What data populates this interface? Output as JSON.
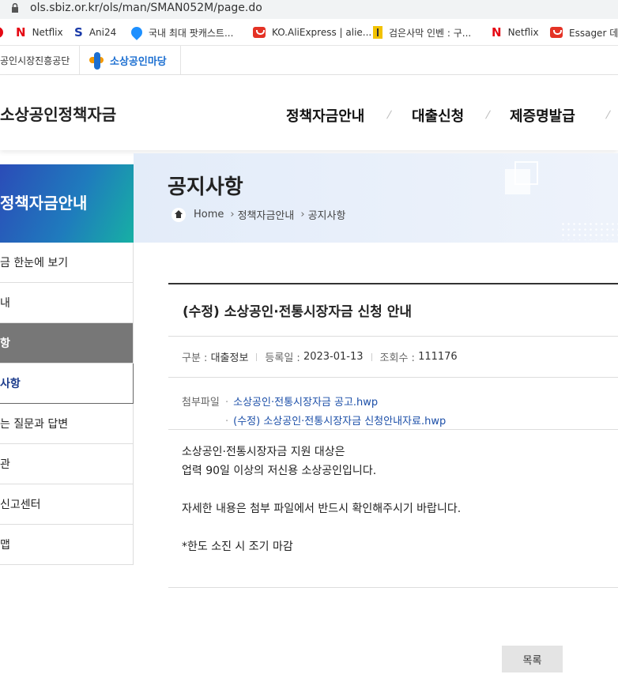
{
  "browser": {
    "url": "ols.sbiz.or.kr/ols/man/SMAN052M/page.do",
    "bookmarks": [
      {
        "label": "Netflix",
        "icon": "netflix-icon"
      },
      {
        "label": "Ani24",
        "icon": "ani24-icon"
      },
      {
        "label": "국내 최대 팟캐스트...",
        "icon": "podcast-icon"
      },
      {
        "label": "KO.AliExpress | alie...",
        "icon": "aliexpress-icon"
      },
      {
        "label": "검은사막 인벤 : 구...",
        "icon": "inven-icon"
      },
      {
        "label": "Netflix",
        "icon": "netflix-icon"
      },
      {
        "label": "Essager 데스",
        "icon": "aliexpress-icon"
      }
    ]
  },
  "site_top": {
    "org_link": "공인시장진흥공단",
    "portal_logo_text": "소상공인마당"
  },
  "header": {
    "brand": "소상공인정책자금",
    "menu": [
      "정책자금안내",
      "대출신청",
      "제증명발급"
    ]
  },
  "banner": {
    "section_title": "정책자금안내",
    "page_title": "공지사항",
    "breadcrumb": [
      "Home",
      "정책자금안내",
      "공지사항"
    ]
  },
  "side_menu": [
    "금 한눈에 보기",
    "내",
    "항",
    "사항",
    "는 질문과 답변",
    "관",
    "신고센터",
    "맵"
  ],
  "notice": {
    "title": "(수정) 소상공인·전통시장자금 신청 안내",
    "category_label": "구분 :",
    "category": "대출정보",
    "date_label": "등록일 :",
    "date": "2023-01-13",
    "views_label": "조회수 :",
    "views": "111176",
    "attach_label": "첨부파일",
    "attachments": [
      "소상공인·전통시장자금 공고.hwp",
      "(수정) 소상공인·전통시장자금 신청안내자료.hwp"
    ],
    "body": [
      "소상공인·전통시장자금 지원 대상은",
      "업력 90일 이상의 저신용 소상공인입니다.",
      "자세한 내용은 첨부 파일에서 반드시 확인해주시기 바랍니다.",
      "*한도 소진 시 조기 마감"
    ],
    "list_button": "목록"
  },
  "colors": {
    "accent_blue": "#1c4fa8",
    "active_menu_bg": "#777777",
    "netflix_red": "#e50914"
  }
}
